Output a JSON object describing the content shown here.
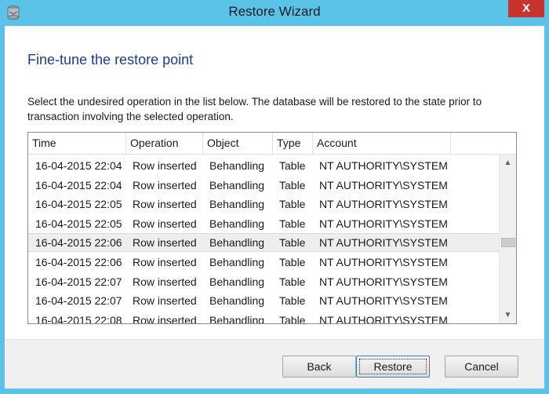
{
  "window": {
    "title": "Restore Wizard",
    "close_glyph": "X"
  },
  "page": {
    "heading": "Fine-tune the restore point",
    "instructions": "Select the undesired operation in the list below. The database will be restored to the state prior to transaction involving the selected operation."
  },
  "list": {
    "columns": [
      "Time",
      "Operation",
      "Object",
      "Type",
      "Account"
    ],
    "rows": [
      [
        "16-04-2015 22:04",
        "Row inserted",
        "Behandling",
        "Table",
        "NT AUTHORITY\\SYSTEM"
      ],
      [
        "16-04-2015 22:04",
        "Row inserted",
        "Behandling",
        "Table",
        "NT AUTHORITY\\SYSTEM"
      ],
      [
        "16-04-2015 22:05",
        "Row inserted",
        "Behandling",
        "Table",
        "NT AUTHORITY\\SYSTEM"
      ],
      [
        "16-04-2015 22:05",
        "Row inserted",
        "Behandling",
        "Table",
        "NT AUTHORITY\\SYSTEM"
      ],
      [
        "16-04-2015 22:06",
        "Row inserted",
        "Behandling",
        "Table",
        "NT AUTHORITY\\SYSTEM"
      ],
      [
        "16-04-2015 22:06",
        "Row inserted",
        "Behandling",
        "Table",
        "NT AUTHORITY\\SYSTEM"
      ],
      [
        "16-04-2015 22:07",
        "Row inserted",
        "Behandling",
        "Table",
        "NT AUTHORITY\\SYSTEM"
      ],
      [
        "16-04-2015 22:07",
        "Row inserted",
        "Behandling",
        "Table",
        "NT AUTHORITY\\SYSTEM"
      ],
      [
        "16-04-2015 22:08",
        "Row inserted",
        "Behandling",
        "Table",
        "NT AUTHORITY\\SYSTEM"
      ]
    ],
    "selected_row": 4
  },
  "buttons": {
    "back": "Back",
    "restore": "Restore",
    "cancel": "Cancel"
  },
  "colors": {
    "title_bar": "#5bc3e8",
    "heading": "#1b3e8c",
    "close_button": "#c7342b"
  },
  "icons": {
    "app": "database-restore-icon",
    "scroll_up": "chevron-up-icon",
    "scroll_down": "chevron-down-icon"
  }
}
